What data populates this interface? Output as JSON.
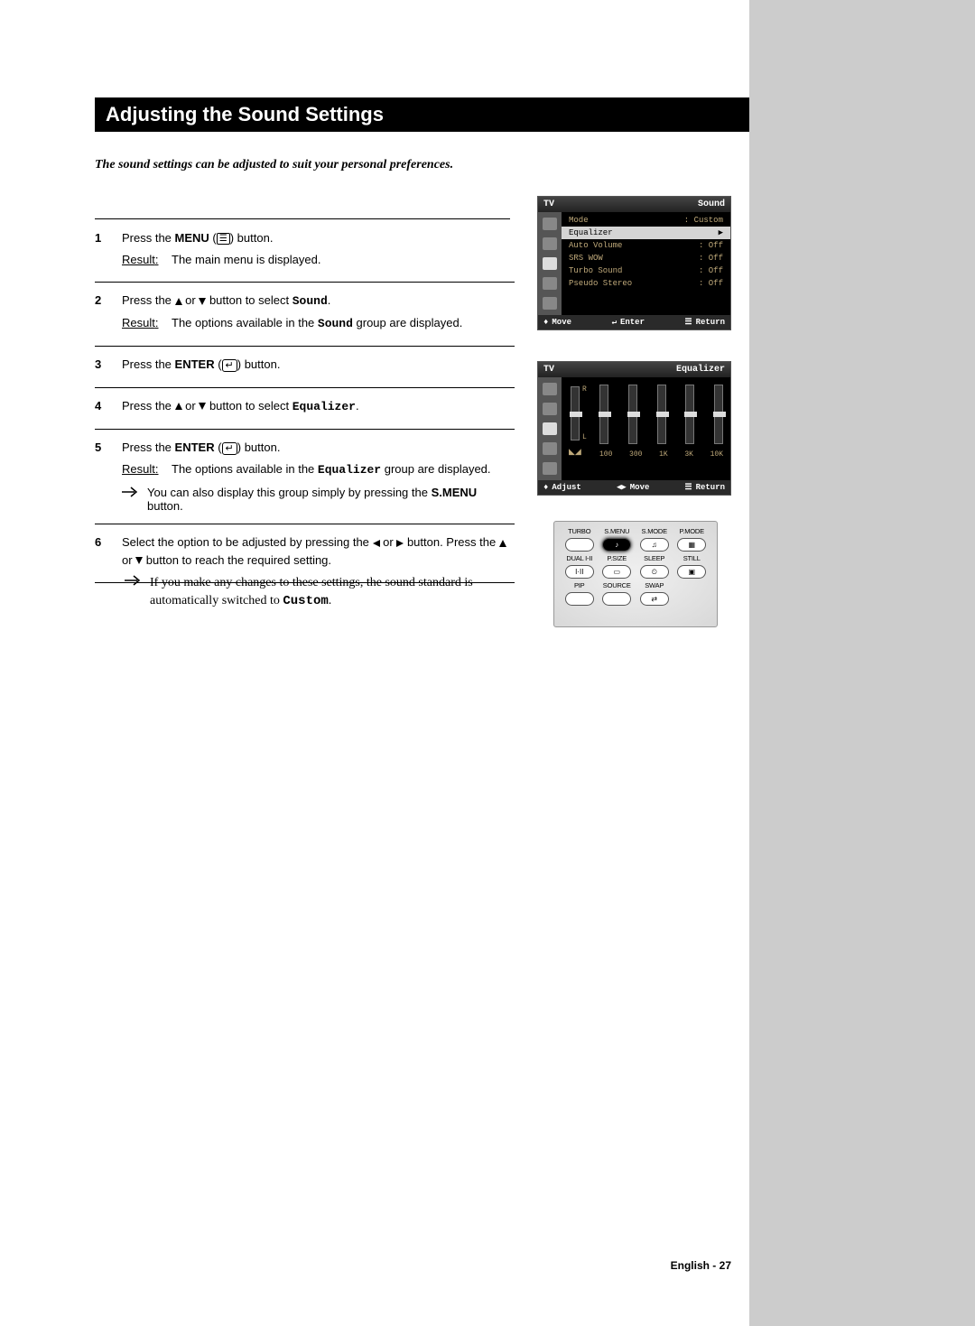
{
  "page": {
    "title": "Adjusting the Sound Settings",
    "intro": "The sound settings can be adjusted to suit your personal preferences.",
    "footer": "English - 27",
    "footnote_prefix": "If you make any changes to these settings, the sound standard is automatically switched to ",
    "footnote_custom": "Custom",
    "footnote_suffix": "."
  },
  "labels": {
    "result": "Result",
    "menu": "MENU",
    "enter": "ENTER",
    "sound": "Sound",
    "equalizer": "Equalizer",
    "smenu": "S.MENU",
    "custom": "Custom"
  },
  "steps": {
    "s1": {
      "num": "1",
      "text_a": "Press the ",
      "text_b": " (",
      "text_c": ") button.",
      "result": "The main menu is displayed."
    },
    "s2": {
      "num": "2",
      "text_a": "Press the ",
      "text_b": " or ",
      "text_c": " button to select ",
      "text_d": ".",
      "result_a": "The options available in the ",
      "result_b": " group are displayed."
    },
    "s3": {
      "num": "3",
      "text_a": "Press the ",
      "text_b": " (",
      "text_c": ") button."
    },
    "s4": {
      "num": "4",
      "text_a": "Press the ",
      "text_b": " or ",
      "text_c": " button to select ",
      "text_d": "."
    },
    "s5": {
      "num": "5",
      "text_a": "Press the ",
      "text_b": " (",
      "text_c": ") button.",
      "result_a": "The options available in the ",
      "result_b": " group are displayed.",
      "note_a": "You can also display this group simply by pressing the ",
      "note_b": " button."
    },
    "s6": {
      "num": "6",
      "text_a": "Select the option to be adjusted by pressing the ",
      "text_b": " or ",
      "text_c": " button. Press the ",
      "text_d": " or ",
      "text_e": " button to reach the required setting."
    }
  },
  "osd1": {
    "tv": "TV",
    "title": "Sound",
    "items": [
      {
        "label": "Mode",
        "value": ": Custom"
      },
      {
        "label": "Equalizer",
        "value": ""
      },
      {
        "label": "Auto Volume",
        "value": ": Off"
      },
      {
        "label": "SRS WOW",
        "value": ": Off"
      },
      {
        "label": "Turbo Sound",
        "value": ": Off"
      },
      {
        "label": "Pseudo Stereo",
        "value": ": Off"
      }
    ],
    "foot": {
      "move": "Move",
      "enter": "Enter",
      "ret": "Return"
    }
  },
  "osd2": {
    "tv": "TV",
    "title": "Equalizer",
    "freq": [
      "100",
      "300",
      "1K",
      "3K",
      "10K"
    ],
    "foot": {
      "adjust": "Adjust",
      "move": "Move",
      "ret": "Return"
    }
  },
  "remote": {
    "row1": [
      "TURBO",
      "S.MENU",
      "S.MODE",
      "P.MODE"
    ],
    "row2": [
      "DUAL I-II",
      "P.SIZE",
      "SLEEP",
      "STILL"
    ],
    "row3": [
      "PIP",
      "SOURCE",
      "SWAP",
      ""
    ]
  }
}
